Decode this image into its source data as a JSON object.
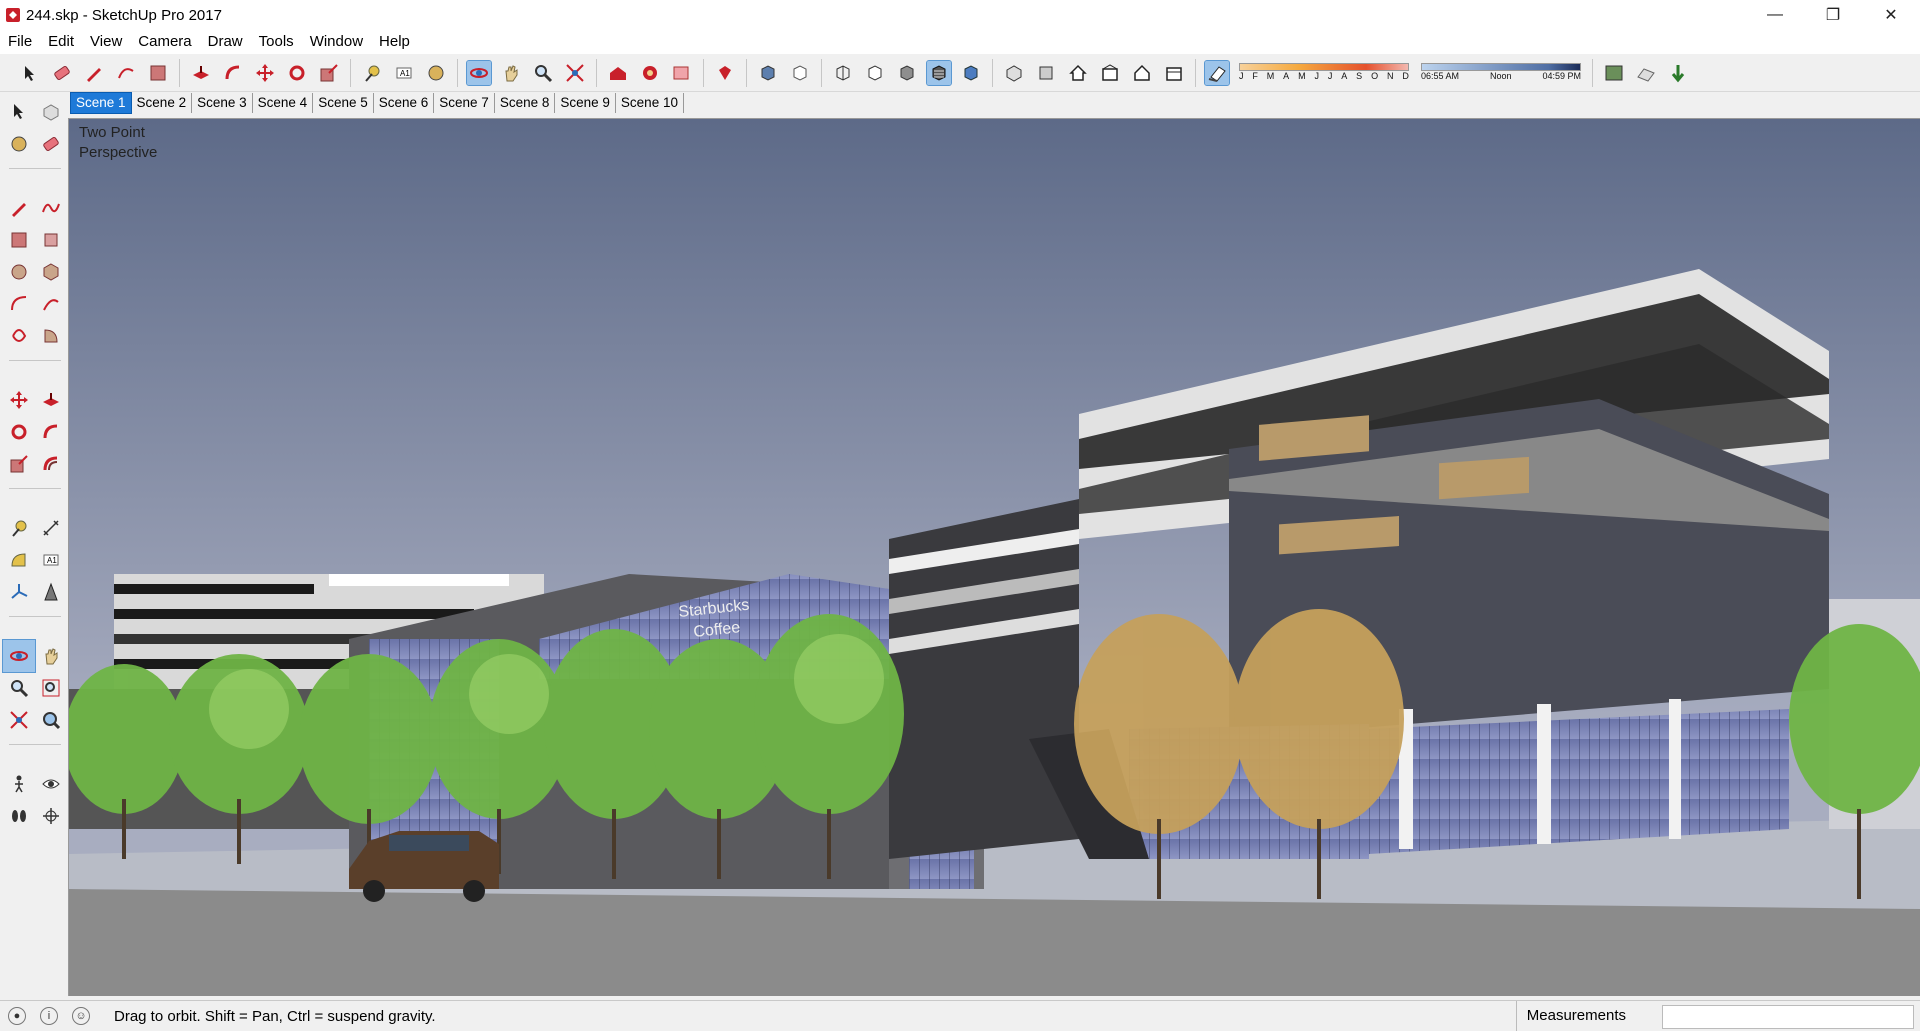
{
  "window": {
    "title": "244.skp - SketchUp Pro 2017",
    "controls": [
      "—",
      "❐",
      "✕"
    ]
  },
  "menu": [
    "File",
    "Edit",
    "View",
    "Camera",
    "Draw",
    "Tools",
    "Window",
    "Help"
  ],
  "shadow_settings": {
    "months": [
      "J",
      "F",
      "M",
      "A",
      "M",
      "J",
      "J",
      "A",
      "S",
      "O",
      "N",
      "D"
    ],
    "time_start": "06:55 AM",
    "time_mid": "Noon",
    "time_end": "04:59 PM"
  },
  "scenes": [
    "Scene 1",
    "Scene 2",
    "Scene 3",
    "Scene 4",
    "Scene 5",
    "Scene 6",
    "Scene 7",
    "Scene 8",
    "Scene 9",
    "Scene 10"
  ],
  "active_scene": "Scene 1",
  "viewport": {
    "camera_label_line1": "Two Point",
    "camera_label_line2": "Perspective"
  },
  "model_signage": {
    "store_line1": "Starbucks",
    "store_line2": "Coffee"
  },
  "status": {
    "message": "Drag to orbit. Shift = Pan, Ctrl = suspend gravity.",
    "measurements_label": "Measurements",
    "measurements_value": ""
  },
  "colors": {
    "accent": "#1e7ad8",
    "sky_top": "#5d6a88",
    "sky_bottom": "#a8adc0",
    "ground": "#8b8b8b"
  }
}
